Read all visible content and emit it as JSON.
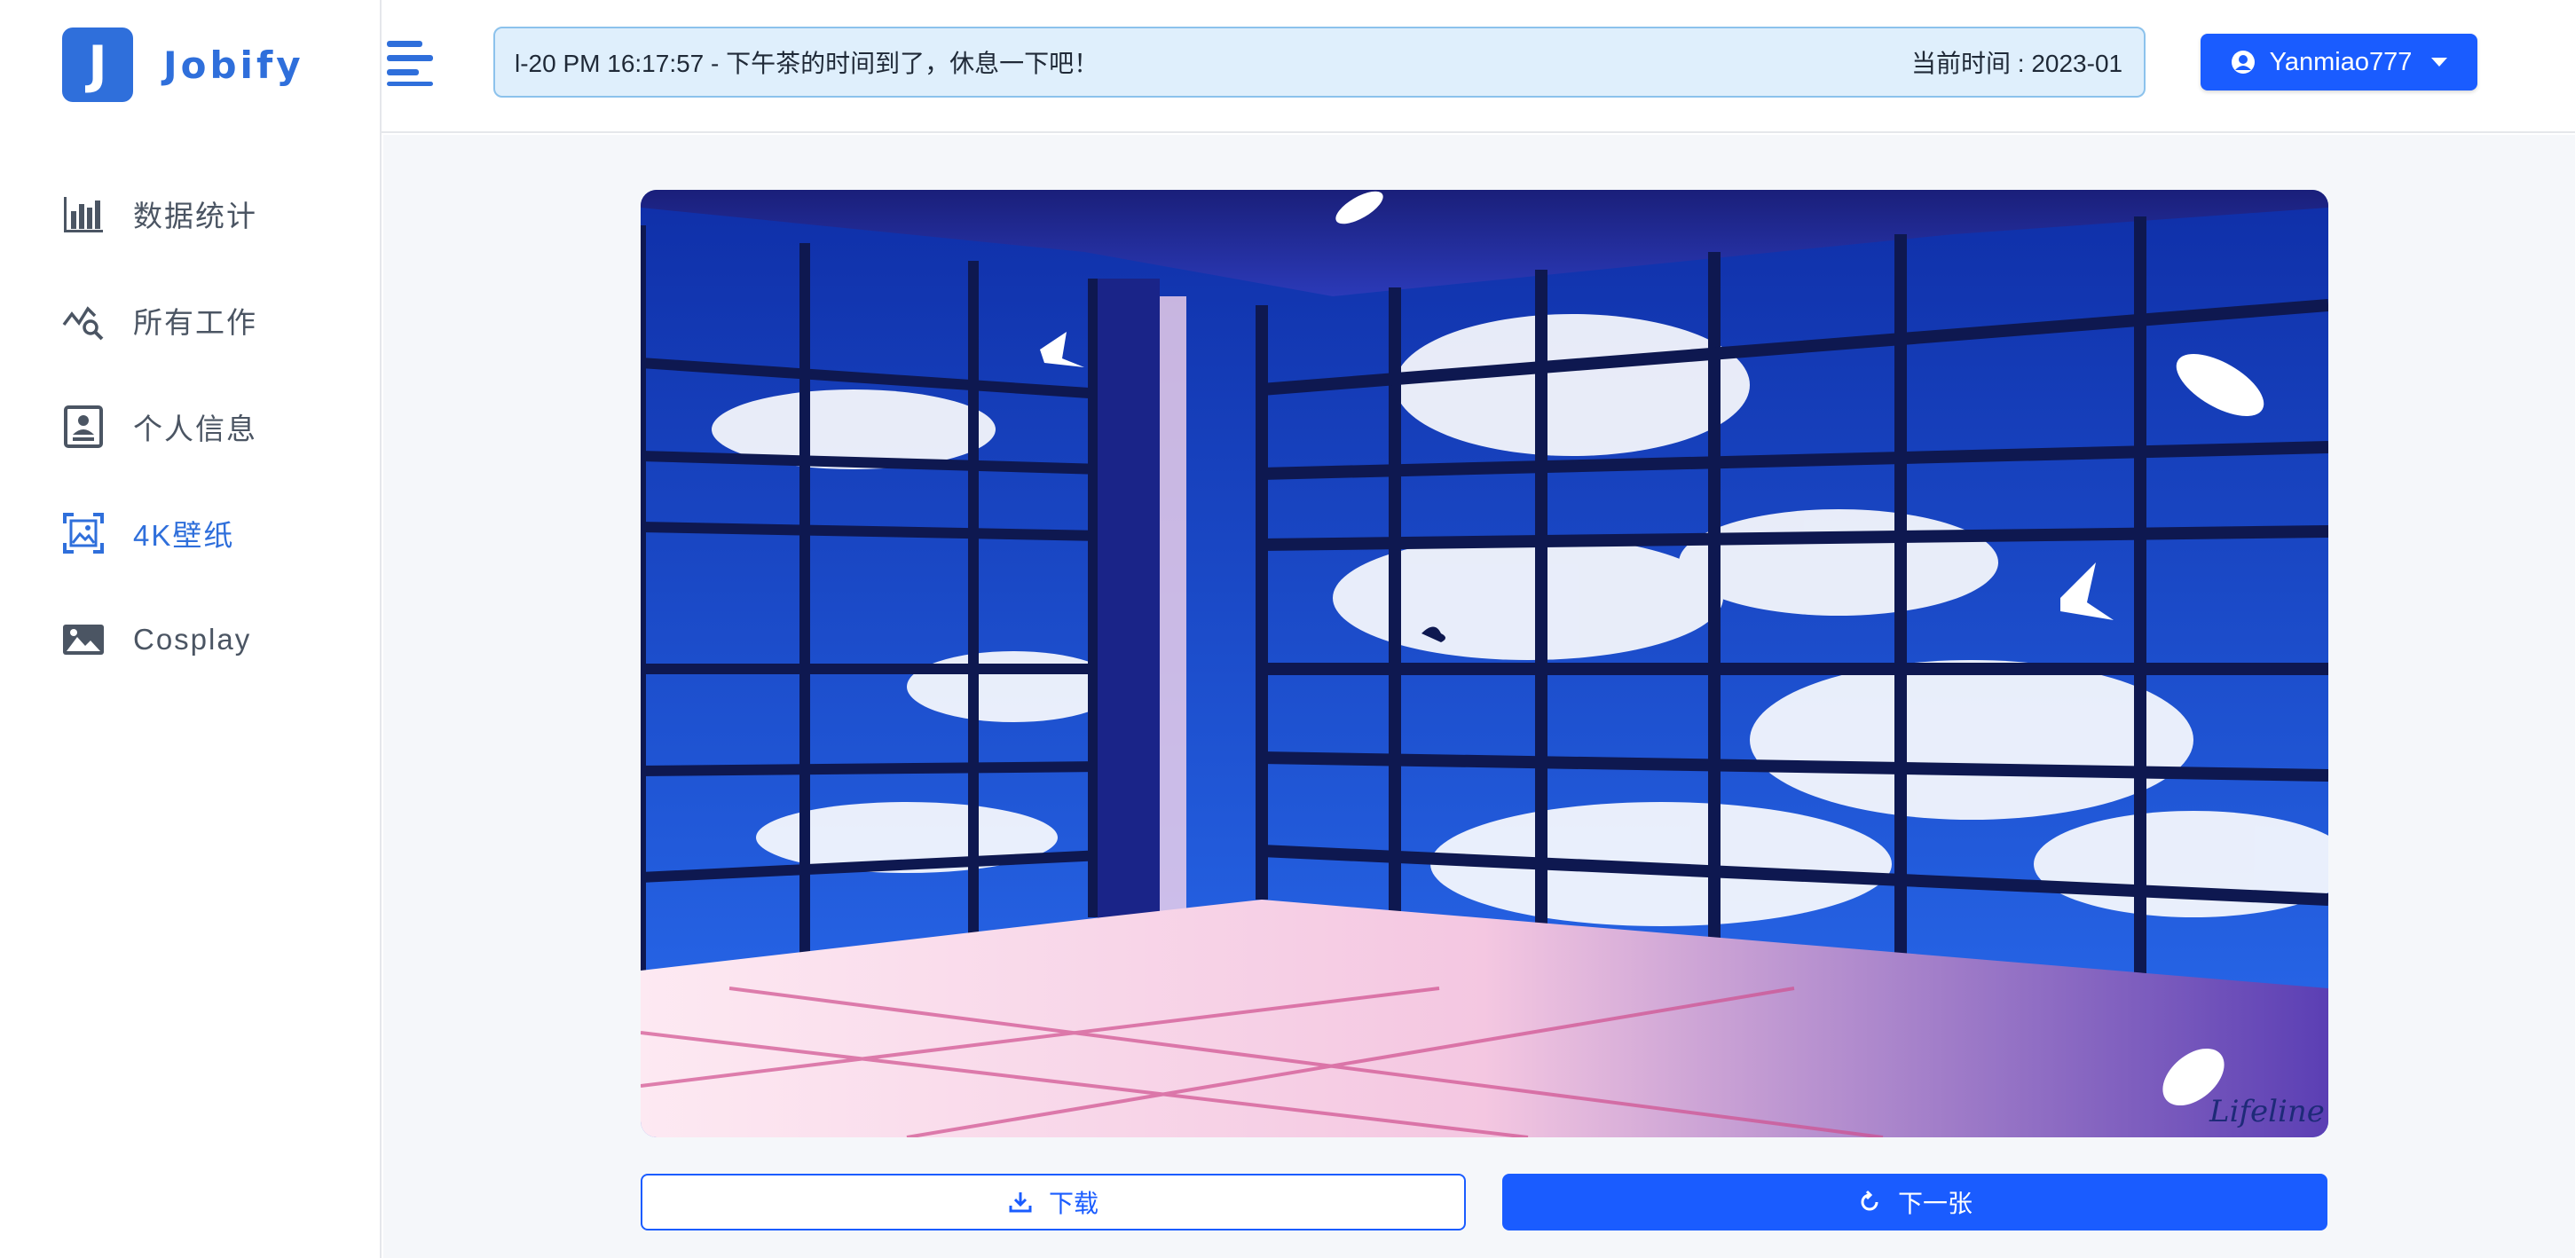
{
  "app": {
    "logo_letter": "J",
    "name": "Jobify",
    "brand_color": "#2f6fdb",
    "accent_color": "#1a5cff"
  },
  "sidebar": {
    "items": [
      {
        "label": "数据统计",
        "icon": "bar-chart-icon",
        "active": false
      },
      {
        "label": "所有工作",
        "icon": "chart-search-icon",
        "active": false
      },
      {
        "label": "个人信息",
        "icon": "profile-card-icon",
        "active": false
      },
      {
        "label": "4K壁纸",
        "icon": "image-frame-icon",
        "active": true
      },
      {
        "label": "Cosplay",
        "icon": "photo-icon",
        "active": false
      }
    ]
  },
  "header": {
    "ticker_message": "l-20 PM 16:17:57 - 下午茶的时间到了，休息一下吧！",
    "ticker_time": "当前时间 : 2023-01",
    "user_name": "Yanmiao777",
    "user_icon": "user-circle-icon",
    "menu_toggle_icon": "menu-align-left-icon"
  },
  "wallpaper": {
    "signature": "Lifeline",
    "sky_color": "#1e4fd0"
  },
  "actions": {
    "download_label": "下载",
    "download_icon": "download-icon",
    "next_label": "下一张",
    "next_icon": "refresh-icon"
  }
}
